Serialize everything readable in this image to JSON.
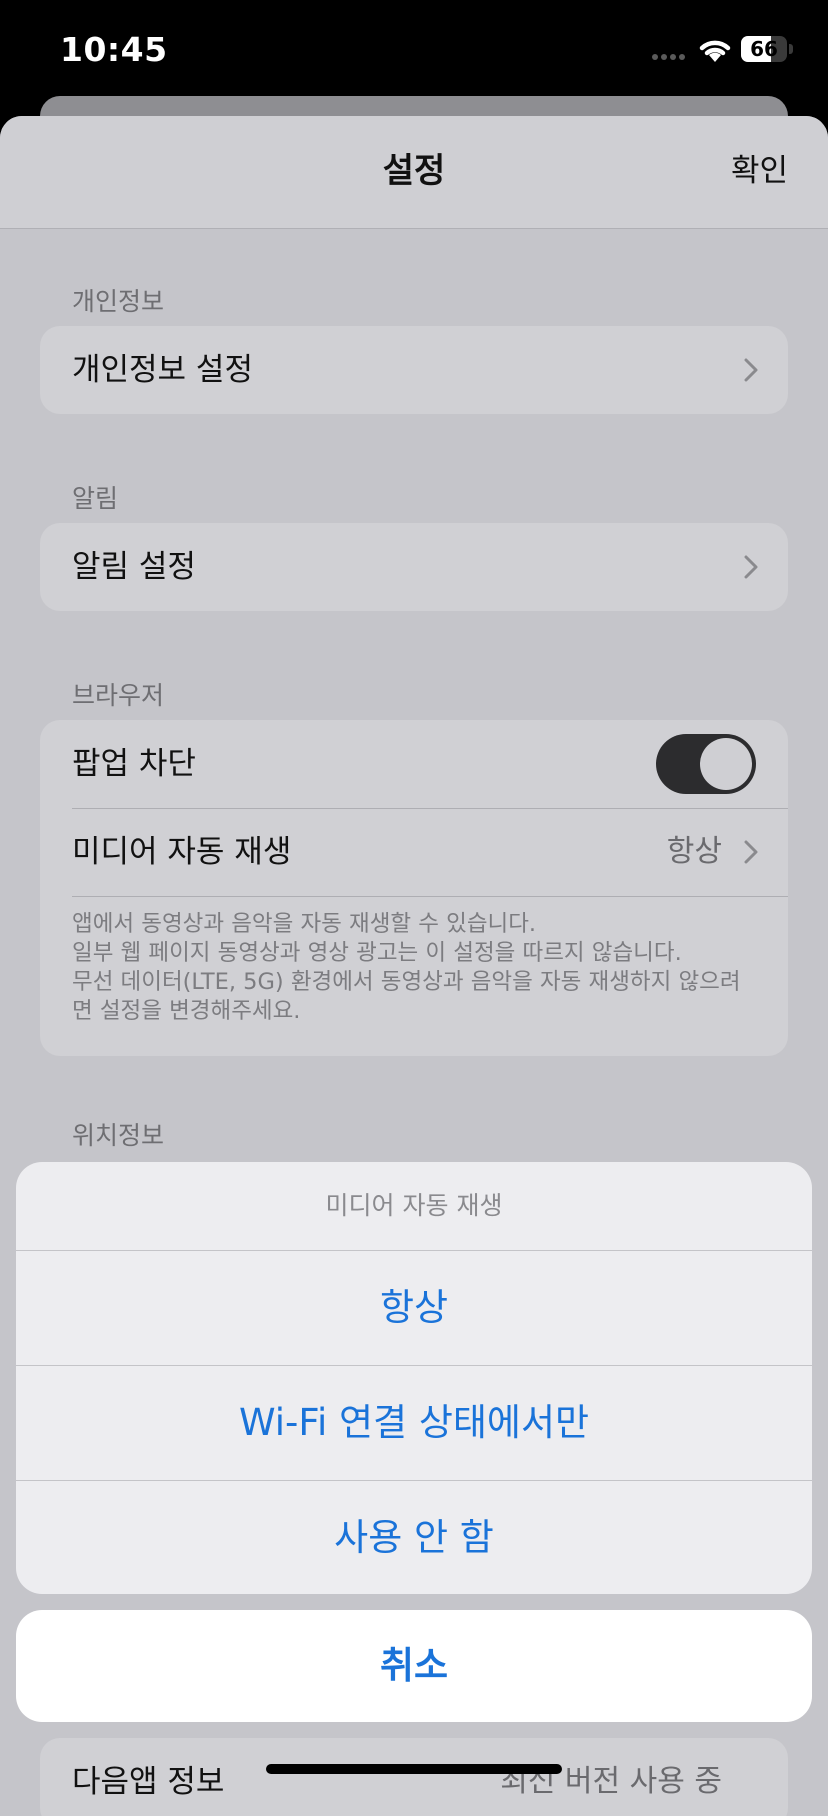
{
  "status": {
    "time": "10:45",
    "battery": "66",
    "battery_level": 0.66
  },
  "nav": {
    "title": "설정",
    "confirm": "확인"
  },
  "sections": {
    "privacy": {
      "header": "개인정보",
      "item": "개인정보 설정"
    },
    "notification": {
      "header": "알림",
      "item": "알림 설정"
    },
    "browser": {
      "header": "브라우저",
      "popup_block": "팝업 차단",
      "popup_block_on": true,
      "media_autoplay": "미디어 자동 재생",
      "media_autoplay_value": "항상",
      "footnote_lines": [
        "앱에서 동영상과 음악을 자동 재생할 수 있습니다.",
        "일부 웹 페이지 동영상과 영상 광고는 이 설정을 따르지 않습니다.",
        "무선 데이터(LTE, 5G) 환경에서 동영상과 음악을 자동 재생하지 않으려",
        "면 설정을 변경해주세요."
      ]
    },
    "location": {
      "header": "위치정보"
    },
    "about": {
      "item": "다음앱 정보",
      "value": "최신 버전 사용 중"
    }
  },
  "action_sheet": {
    "title": "미디어 자동 재생",
    "options": [
      "항상",
      "Wi-Fi 연결 상태에서만",
      "사용 안 함"
    ],
    "cancel": "취소"
  }
}
